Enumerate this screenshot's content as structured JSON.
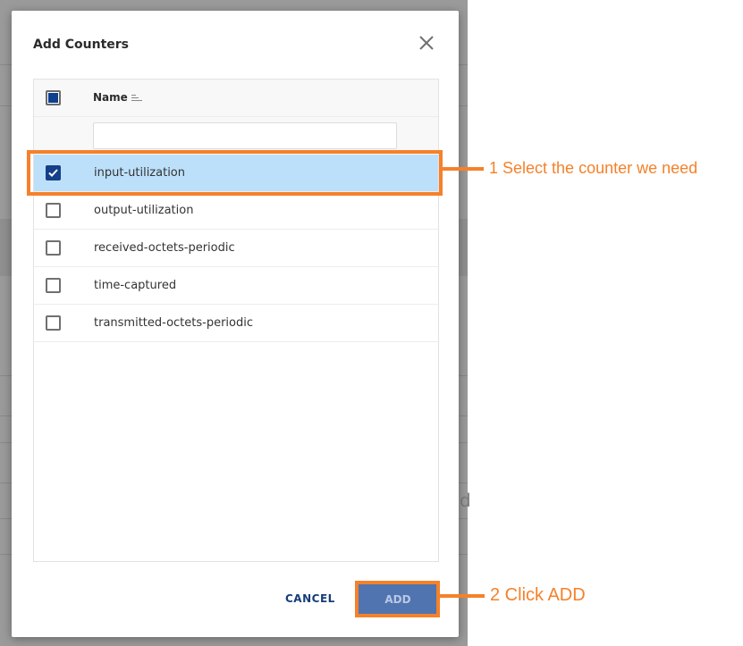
{
  "dialog": {
    "title": "Add Counters",
    "close_icon": "close-icon"
  },
  "table": {
    "header": {
      "name_label": "Name",
      "select_all_state": "partial",
      "sort_icon": "sort-icon"
    },
    "filter": {
      "value": "",
      "placeholder": ""
    },
    "rows": [
      {
        "label": "input-utilization",
        "checked": true
      },
      {
        "label": "output-utilization",
        "checked": false
      },
      {
        "label": "received-octets-periodic",
        "checked": false
      },
      {
        "label": "time-captured",
        "checked": false
      },
      {
        "label": "transmitted-octets-periodic",
        "checked": false
      }
    ]
  },
  "footer": {
    "cancel_label": "CANCEL",
    "add_label": "ADD"
  },
  "annotations": {
    "step1": "1 Select the counter we need",
    "step2": "2 Click ADD",
    "color": "#f5812a"
  },
  "colors": {
    "accent": "#163f8a",
    "selected_row": "#bde0fa",
    "add_button": "#5074b0"
  }
}
